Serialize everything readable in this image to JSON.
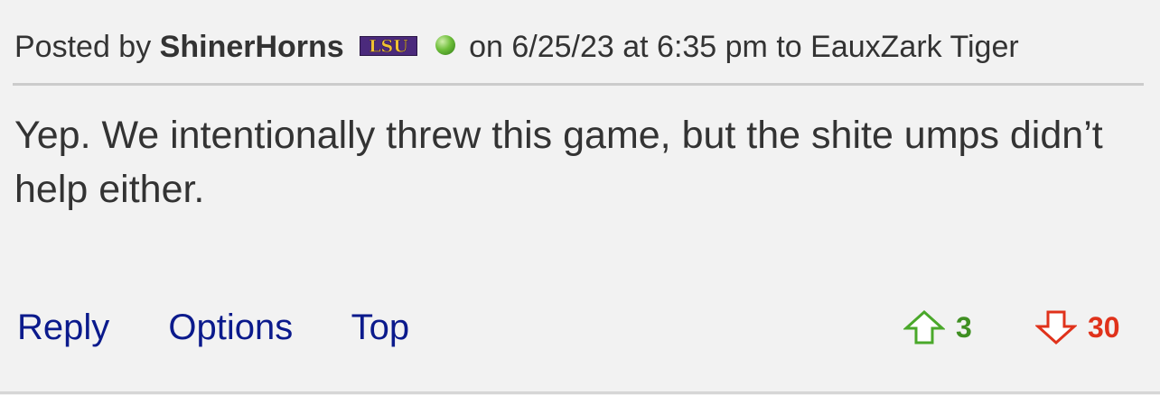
{
  "post": {
    "posted_by_label": "Posted by",
    "author": "ShinerHorns",
    "team_badge": "LSU",
    "status_icon": "green-dot-icon",
    "date_text": "on 6/25/23 at 6:35 pm",
    "reply_to_text": "to EauxZark Tiger",
    "body": "Yep. We intentionally threw this game, but the shite umps didn’t help either."
  },
  "actions": {
    "reply": "Reply",
    "options": "Options",
    "top": "Top"
  },
  "votes": {
    "up_count": "3",
    "down_count": "30",
    "up_color": "#3f8f22",
    "down_color": "#e0321b"
  },
  "colors": {
    "background": "#f2f2f2",
    "link": "#0b1a8c",
    "badge_purple": "#4b2a7c",
    "badge_gold": "#f1c232"
  }
}
